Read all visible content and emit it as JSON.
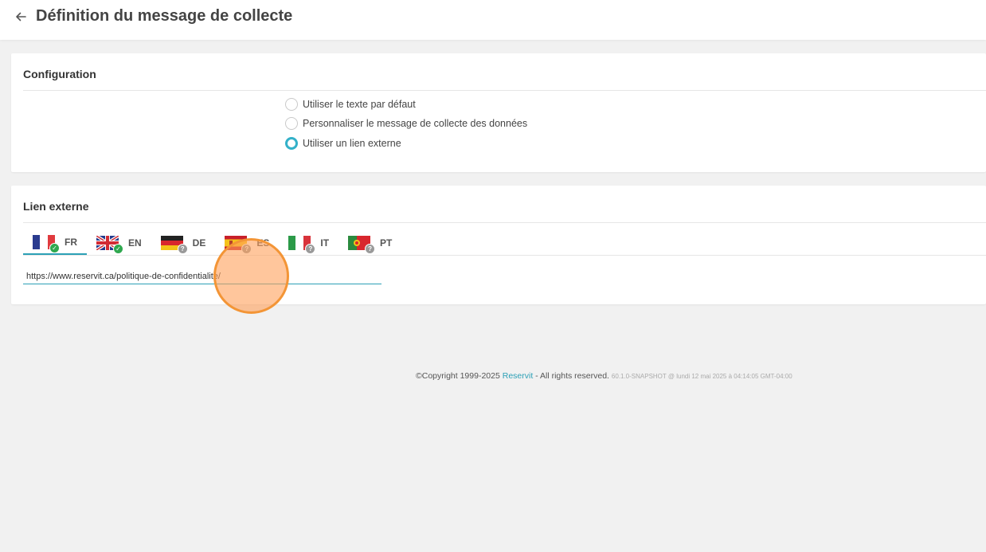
{
  "header": {
    "title": "Définition du message de collecte",
    "back_icon": "arrow-left-icon"
  },
  "configuration": {
    "title": "Configuration",
    "options": [
      {
        "label": "Utiliser le texte par défaut",
        "checked": false
      },
      {
        "label": "Personnaliser le message de collecte des données",
        "checked": false
      },
      {
        "label": "Utiliser un lien externe",
        "checked": true
      }
    ]
  },
  "external_link": {
    "title": "Lien externe",
    "tabs": [
      {
        "code": "FR",
        "flag": "flag-france-icon",
        "status": "complete",
        "active": true
      },
      {
        "code": "EN",
        "flag": "flag-uk-icon",
        "status": "complete",
        "active": false
      },
      {
        "code": "DE",
        "flag": "flag-germany-icon",
        "status": "unknown",
        "active": false
      },
      {
        "code": "ES",
        "flag": "flag-spain-icon",
        "status": "unknown",
        "active": false
      },
      {
        "code": "IT",
        "flag": "flag-italy-icon",
        "status": "unknown",
        "active": false
      },
      {
        "code": "PT",
        "flag": "flag-portugal-icon",
        "status": "unknown",
        "active": false
      }
    ],
    "url_value": "https://www.reservit.ca/politique-de-confidentialite/",
    "status_icons": {
      "complete": "✓",
      "unknown": "?"
    }
  },
  "footer": {
    "copyright": "©Copyright 1999-2025 ",
    "brand": "Reservit",
    "rights": " - All rights reserved. ",
    "version": "60.1.0-SNAPSHOT @ lundi 12 mai 2025 à 04:14:05 GMT-04:00"
  },
  "colors": {
    "accent": "#2ca0b6",
    "radio_checked": "#33b1c9",
    "status_ok": "#2fa84f",
    "status_unknown": "#9a9a9a",
    "click_indicator": "#f39536"
  }
}
